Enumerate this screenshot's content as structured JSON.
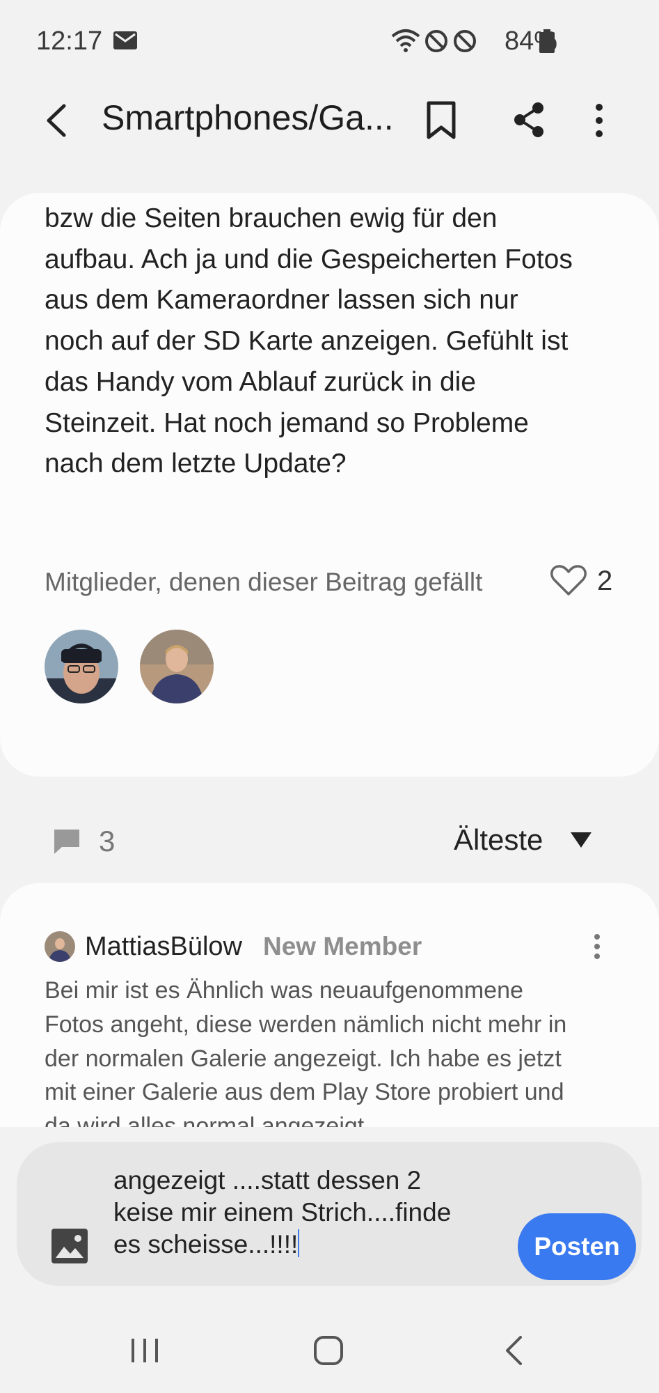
{
  "status_bar": {
    "time": "12:17",
    "battery": "84%",
    "icons": [
      "mail-icon",
      "wifi-icon",
      "dnd-icon",
      "dnd-icon",
      "battery-icon"
    ]
  },
  "app_bar": {
    "title": "Smartphones/Ga...",
    "icons": [
      "back-icon",
      "bookmark-icon",
      "share-icon",
      "more-icon"
    ]
  },
  "post": {
    "body_lines": [
      "bzw die Seiten brauchen ewig für den",
      "aufbau. Ach ja und die Gespeicherten Fotos",
      "aus dem Kameraordner lassen sich nur",
      "noch auf der SD Karte anzeigen. Gefühlt ist",
      "das Handy vom Ablauf zurück in die",
      "Steinzeit. Hat noch jemand so Probleme",
      "nach dem letzte Update?"
    ],
    "likes_label": "Mitglieder, denen dieser Beitrag gefällt",
    "likes_count": "2"
  },
  "comments_header": {
    "count": "3",
    "sort_label": "Älteste"
  },
  "comment": {
    "author": "MattiasBülow",
    "badge": "New Member",
    "text_lines": [
      "Bei mir ist es Ähnlich was neuaufgenommene",
      "Fotos angeht, diese werden nämlich nicht mehr in",
      "der normalen Galerie angezeigt. Ich habe es jetzt",
      "mit einer Galerie aus dem Play Store probiert und",
      "da wird alles normal angezeigt."
    ]
  },
  "composer": {
    "lines": [
      "angezeigt ....statt dessen 2",
      "keise mir einem Strich....finde",
      "es scheisse...!!!!"
    ],
    "post_label": "Posten"
  },
  "colors": {
    "accent": "#3a7af0",
    "badge": "#8e8e8e",
    "background": "#f2f2f2",
    "card": "#fcfcfc"
  }
}
